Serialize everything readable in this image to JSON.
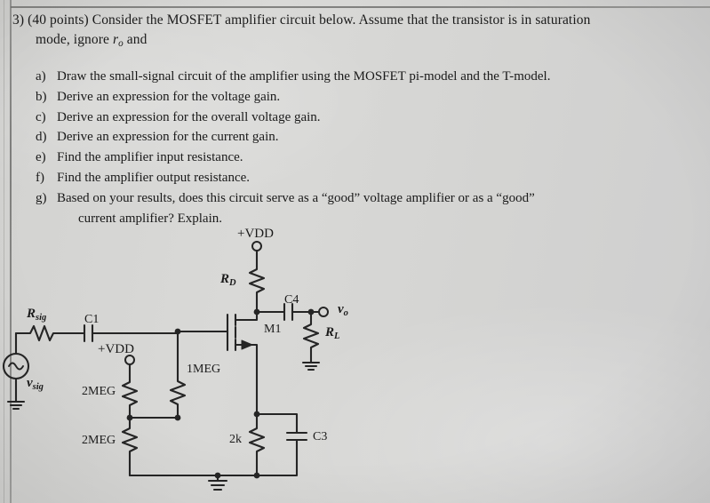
{
  "document": {
    "question": {
      "number": "3)",
      "points": "(40 points)",
      "line1": "3) (40 points) Consider the MOSFET amplifier circuit below. Assume that the transistor is in saturation",
      "line2_prefix": "mode, ignore ",
      "line2_var": "r",
      "line2_sub": "o",
      "line2_suffix": " and"
    },
    "parts": [
      {
        "label": "a)",
        "text": "Draw the small-signal circuit of the amplifier using the MOSFET pi-model and the T-model."
      },
      {
        "label": "b)",
        "text": "Derive an expression for the voltage gain."
      },
      {
        "label": "c)",
        "text": "Derive an expression for the overall voltage gain."
      },
      {
        "label": "d)",
        "text": "Derive an expression for the current gain."
      },
      {
        "label": "e)",
        "text": "Find the amplifier input resistance."
      },
      {
        "label": "f)",
        "text": "Find the amplifier output resistance."
      },
      {
        "label": "g)",
        "text": "Based on your results, does this circuit serve as a “good” voltage amplifier or as a “good”",
        "text2": "current amplifier? Explain."
      }
    ]
  },
  "circuit": {
    "title": "MOSFET common-source amplifier",
    "ink_color": "#252525",
    "labels": {
      "vdd_top": "+VDD",
      "vdd_bias": "+VDD",
      "rd": {
        "main": "R",
        "sub": "D"
      },
      "rsig": {
        "main": "R",
        "sub": "sig"
      },
      "vsig": {
        "main": "v",
        "sub": "sig"
      },
      "vo": {
        "main": "v",
        "sub": "o"
      },
      "rl": {
        "main": "R",
        "sub": "L"
      },
      "c1": "C1",
      "c3": "C3",
      "c4": "C4",
      "m1": "M1",
      "rg1": "2MEG",
      "rg2": "2MEG",
      "rg_gate": "1MEG",
      "rs": "2k"
    },
    "components": [
      {
        "name": "Rsig",
        "value": "R_sig",
        "type": "resistor"
      },
      {
        "name": "C1",
        "value": "C1",
        "type": "capacitor"
      },
      {
        "name": "RG1",
        "value": "2MEG",
        "type": "resistor"
      },
      {
        "name": "RG2",
        "value": "2MEG",
        "type": "resistor"
      },
      {
        "name": "RG3",
        "value": "1MEG",
        "type": "resistor"
      },
      {
        "name": "RD",
        "value": "R_D",
        "type": "resistor"
      },
      {
        "name": "RS",
        "value": "2k",
        "type": "resistor"
      },
      {
        "name": "C3",
        "value": "C3",
        "type": "capacitor"
      },
      {
        "name": "C4",
        "value": "C4",
        "type": "capacitor"
      },
      {
        "name": "RL",
        "value": "R_L",
        "type": "resistor"
      },
      {
        "name": "M1",
        "value": "M1",
        "type": "nmos"
      },
      {
        "name": "vsig",
        "value": "v_sig",
        "type": "ac-source"
      }
    ]
  }
}
